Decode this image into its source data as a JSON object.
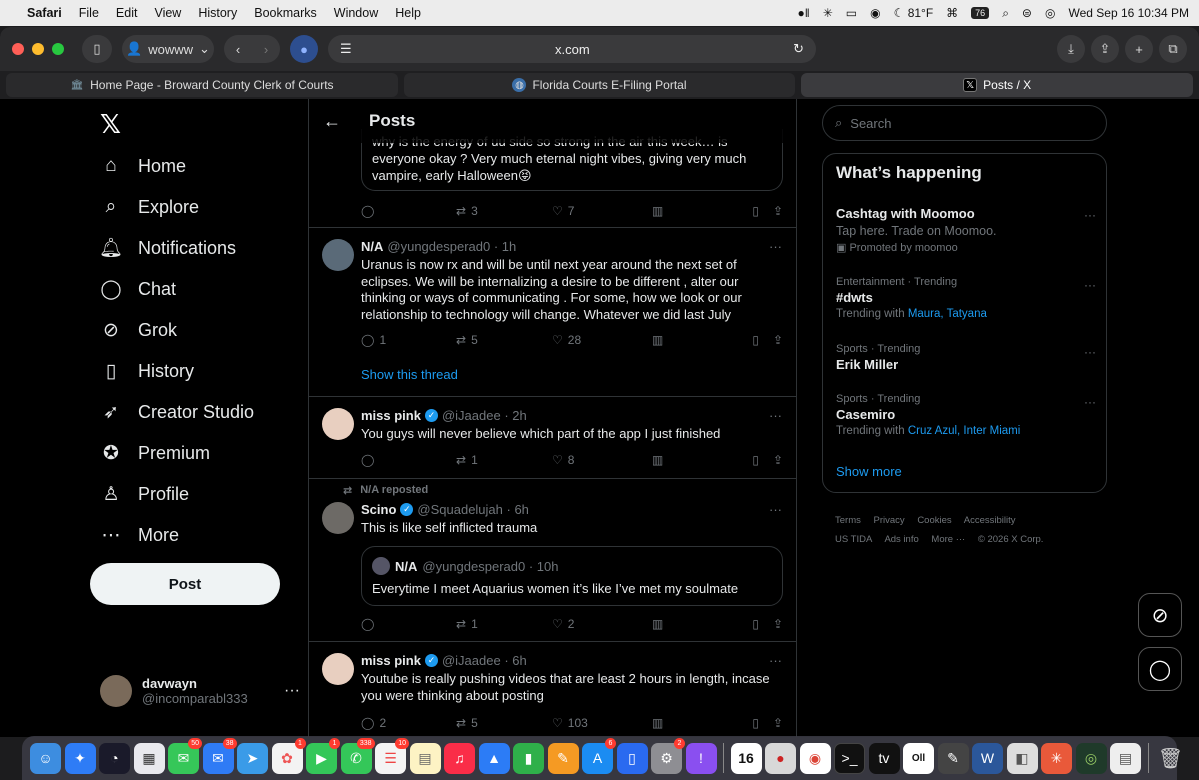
{
  "menubar": {
    "app": "Safari",
    "menus": [
      "File",
      "Edit",
      "View",
      "History",
      "Bookmarks",
      "Window",
      "Help"
    ],
    "temperature": "81°F",
    "battery": "76",
    "datetime": "Wed Sep 16  10:34 PM"
  },
  "toolbar": {
    "profile": "wowww",
    "url": "x.com"
  },
  "tabs": [
    {
      "label": "Home Page - Broward County Clerk of Courts",
      "icon": "building-icon"
    },
    {
      "label": "Florida Courts E-Filing Portal",
      "icon": "globe-icon"
    },
    {
      "label": "Posts / X",
      "icon": "x-icon"
    }
  ],
  "nav": {
    "items": [
      "Home",
      "Explore",
      "Notifications",
      "Chat",
      "Grok",
      "History",
      "Creator Studio",
      "Premium",
      "Profile",
      "More"
    ],
    "post_label": "Post"
  },
  "account": {
    "name": "davwayn",
    "handle": "@incomparabl333"
  },
  "timeline": {
    "title": "Posts",
    "top_quote": "why is the energy of uu side so strong in the air this week… is everyone okay ? Very much eternal night vibes, giving very much vampire, early Halloween😝",
    "top_actions": {
      "replies": "",
      "reposts": "3",
      "likes": "7"
    },
    "posts": [
      {
        "name": "N/A",
        "handle": "@yungdesperad0 · 1h",
        "body": "Uranus is now rx and will be until next year around the next set of eclipses. We will be internalizing a desire to be different , alter our thinking or ways of communicating . For some, how we look or our relationship to technology will change. Whatever we did last July",
        "replies": "1",
        "reposts": "5",
        "likes": "28",
        "thread": "Show this thread"
      },
      {
        "name": "miss pink",
        "handle": "@iJaadee · 2h",
        "body": "You guys will never believe which part of the app I just finished",
        "replies": "",
        "reposts": "1",
        "likes": "8"
      },
      {
        "repost_by": "N/A reposted",
        "name": "Scino",
        "handle": "@Squadelujah · 6h",
        "body": "This is like self inflicted trauma",
        "quote_name": "N/A",
        "quote_handle": "@yungdesperad0 · 10h",
        "quote_body": "Everytime I meet Aquarius women it’s like I’ve met my soulmate",
        "replies": "",
        "reposts": "1",
        "likes": "2"
      },
      {
        "name": "miss pink",
        "handle": "@iJaadee · 6h",
        "body": "Youtube is really pushing videos that are least 2 hours in length, incase you were thinking about posting",
        "replies": "2",
        "reposts": "5",
        "likes": "103"
      }
    ]
  },
  "right": {
    "search_placeholder": "Search",
    "trends_title": "What’s happening",
    "trends": [
      {
        "meta": "",
        "title": "Cashtag with Moomoo",
        "sub": "Tap here. Trade on Moomoo.",
        "promo": "Promoted by moomoo"
      },
      {
        "meta": "Entertainment · Trending",
        "title": "#dwts",
        "sub": "Trending with ",
        "links": "Maura, Tatyana"
      },
      {
        "meta": "Sports · Trending",
        "title": "Erik Miller"
      },
      {
        "meta": "Sports · Trending",
        "title": "Casemiro",
        "sub": "Trending with ",
        "links": "Cruz Azul, Inter Miami"
      }
    ],
    "show_more": "Show more",
    "footer": [
      "Terms",
      "Privacy",
      "Cookies",
      "Accessibility",
      "US TIDA",
      "Ads info",
      "More ···",
      "© 2026 X Corp."
    ]
  },
  "dock_badges": {
    "messages": "50",
    "mail": "38",
    "photos": "1",
    "facetime": "1",
    "phone": "338",
    "reminders": "10",
    "appstore": "6",
    "settings": "2"
  },
  "calendar_day": "16"
}
